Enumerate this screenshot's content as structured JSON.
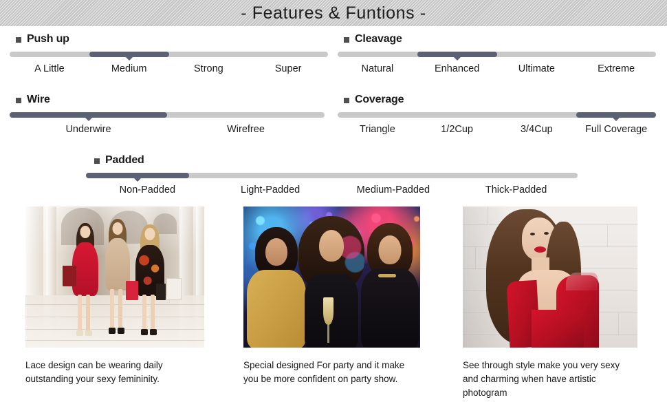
{
  "header": {
    "title": "- Features & Funtions -"
  },
  "features": [
    {
      "id": "pushup",
      "heading": "Push up",
      "bullet_icon": "square-bullet-icon",
      "options": [
        "A  Little",
        "Medium",
        "Strong",
        "Super"
      ],
      "selected_index": 1,
      "fill_start_pct": 25,
      "fill_end_pct": 50
    },
    {
      "id": "cleavage",
      "heading": "Cleavage",
      "bullet_icon": "square-bullet-icon",
      "options": [
        "Natural",
        "Enhanced",
        "Ultimate",
        "Extreme"
      ],
      "selected_index": 1,
      "fill_start_pct": 25,
      "fill_end_pct": 50
    },
    {
      "id": "wire",
      "heading": "Wire",
      "bullet_icon": "square-bullet-icon",
      "options": [
        "Underwire",
        "Wirefree"
      ],
      "selected_index": 0,
      "fill_start_pct": 0,
      "fill_end_pct": 50
    },
    {
      "id": "coverage",
      "heading": "Coverage",
      "bullet_icon": "square-bullet-icon",
      "options": [
        "Triangle",
        "1/2Cup",
        "3/4Cup",
        "Full Coverage"
      ],
      "selected_index": 3,
      "fill_start_pct": 75,
      "fill_end_pct": 100
    },
    {
      "id": "padded",
      "heading": "Padded",
      "bullet_icon": "square-bullet-icon",
      "options": [
        "Non-Padded",
        "Light-Padded",
        "Medium-Padded",
        "Thick-Padded"
      ],
      "selected_index": 0,
      "fill_start_pct": 0,
      "fill_end_pct": 21
    }
  ],
  "cards": [
    {
      "id": "daily",
      "photo_alt": "three-women-shopping-in-mall",
      "caption": "Lace design can be wearing daily outstanding your sexy femininity."
    },
    {
      "id": "party",
      "photo_alt": "three-women-at-nightclub-party-with-champagne",
      "caption": "Special designed For party and it make you be more confident on party show."
    },
    {
      "id": "seethrough",
      "photo_alt": "woman-in-red-v-neck-dress-against-white-brick-wall",
      "caption": "See through style make you very sexy and charming when have artistic photogram"
    }
  ],
  "colors": {
    "header_band": "#cfcfcf",
    "track_inactive": "#c9c9c9",
    "track_active": "#5b6273",
    "bullet": "#4f4f4f",
    "text": "#1a1a1a"
  }
}
